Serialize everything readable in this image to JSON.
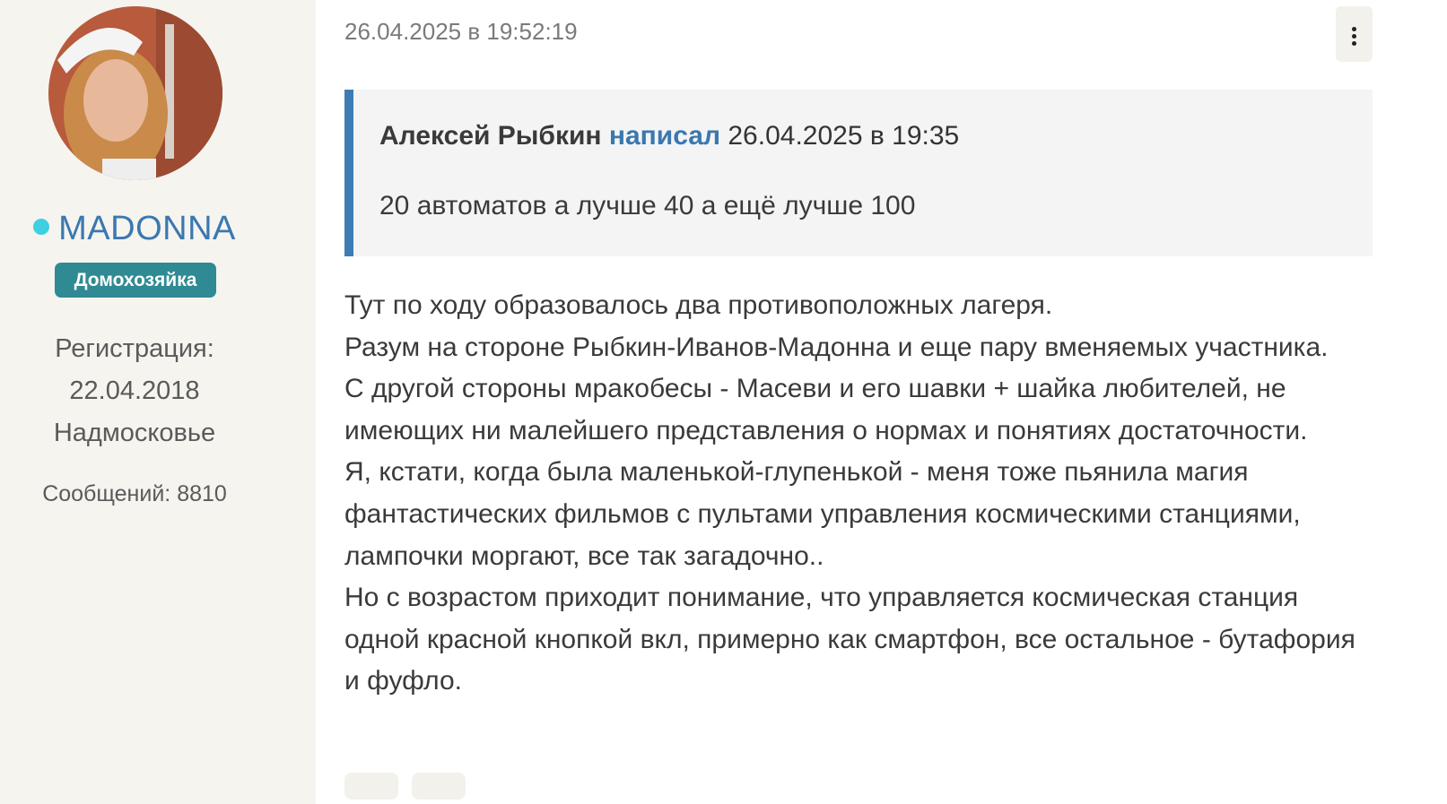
{
  "user": {
    "name": "MADONNA",
    "role": "Домохозяйка",
    "registration_label": "Регистрация:",
    "registration_date": "22.04.2018",
    "location": "Надмосковье",
    "messages": "Сообщений: 8810",
    "online_color": "#3ecfe0"
  },
  "post": {
    "timestamp": "26.04.2025 в 19:52:19",
    "menu_icon": "more-vertical-icon",
    "quote": {
      "author": "Алексей Рыбкин",
      "wrote_link": "написал",
      "date": "26.04.2025 в 19:35",
      "text": "20 автоматов а лучше 40 а ещё лучше 100"
    },
    "lines": [
      "Тут по ходу образовалось два противоположных лагеря.",
      "Разум на стороне Рыбкин-Иванов-Мадонна и еще пару вменяемых участника.",
      "С другой стороны мракобесы - Масеви и его шавки + шайка любителей, не имеющих ни малейшего представления о нормах и понятиях достаточности.",
      "Я, кстати, когда была маленькой-глупенькой - меня тоже пьянила магия фантастических фильмов с пультами управления космическими станциями, лампочки моргают, все так загадочно..",
      "Но с возрастом приходит понимание, что управляется космическая станция одной красной кнопкой вкл, примерно как смартфон, все остальное - бутафория и фуфло."
    ]
  },
  "colors": {
    "accent": "#3a78b0",
    "badge": "#2f8a93",
    "quote_border": "#3e7bb5",
    "sidebar_bg": "#f5f4ef"
  }
}
